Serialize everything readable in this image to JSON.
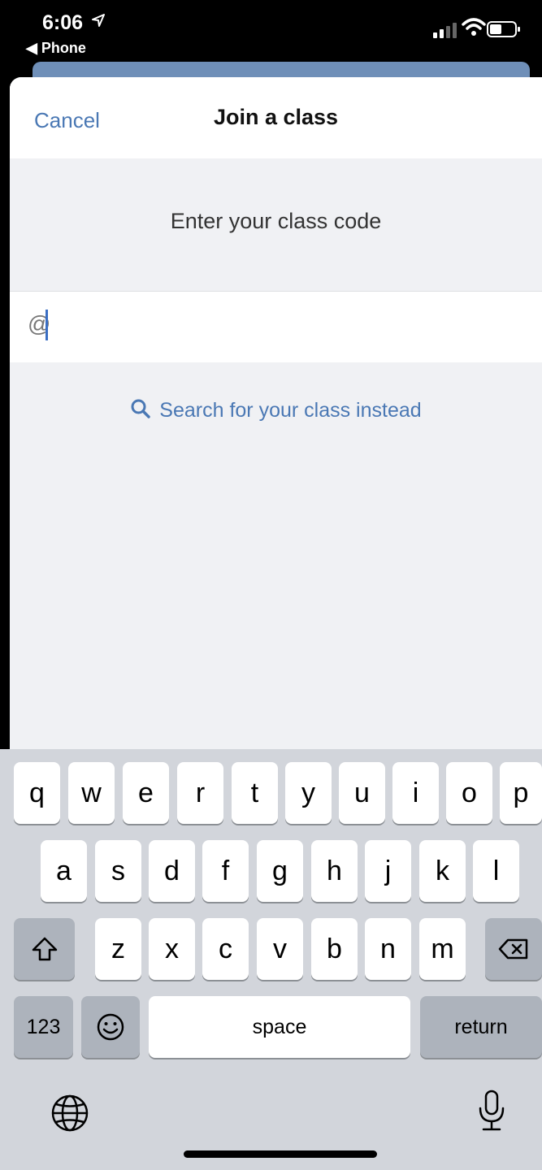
{
  "status_bar": {
    "time": "6:06",
    "back_app": "◀ Phone"
  },
  "nav": {
    "cancel_label": "Cancel",
    "title": "Join a class"
  },
  "form": {
    "prompt": "Enter your class code",
    "code_value": "@",
    "search_link": "Search for your class instead"
  },
  "keyboard": {
    "row1": [
      "q",
      "w",
      "e",
      "r",
      "t",
      "y",
      "u",
      "i",
      "o",
      "p"
    ],
    "row2": [
      "a",
      "s",
      "d",
      "f",
      "g",
      "h",
      "j",
      "k",
      "l"
    ],
    "row3": [
      "z",
      "x",
      "c",
      "v",
      "b",
      "n",
      "m"
    ],
    "numbers_label": "123",
    "space_label": "space",
    "return_label": "return"
  },
  "colors": {
    "accent": "#4a78b4",
    "caret": "#3a6ec3",
    "keyboard_bg": "#d2d5db"
  }
}
